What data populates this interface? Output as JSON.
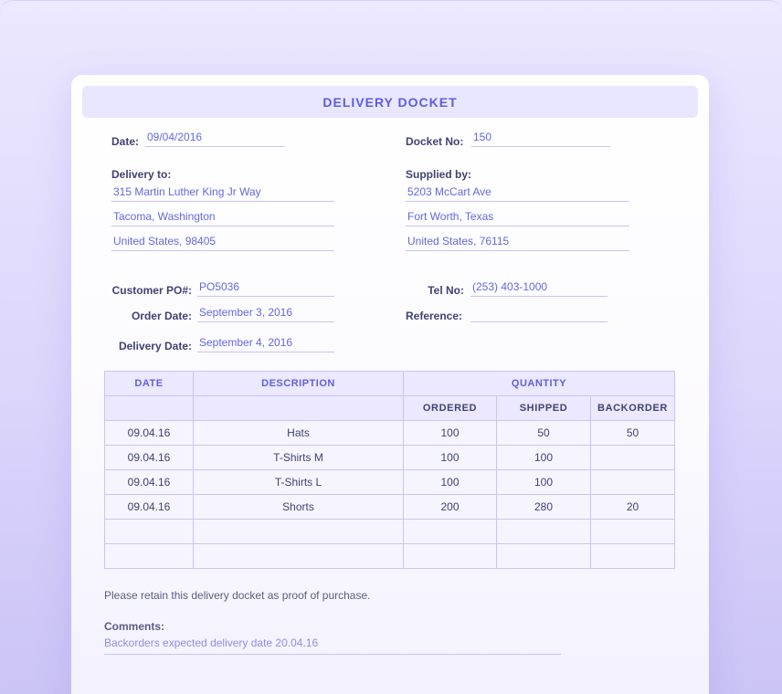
{
  "title": "DELIVERY DOCKET",
  "date": {
    "label": "Date:",
    "value": "09/04/2016"
  },
  "docket": {
    "label": "Docket No:",
    "value": "150"
  },
  "delivery_to": {
    "label": "Delivery to:",
    "lines": [
      "315 Martin Luther King Jr Way",
      "Tacoma, Washington",
      "United States, 98405"
    ]
  },
  "supplied_by": {
    "label": "Supplied by:",
    "lines": [
      "5203 McCart Ave",
      "Fort Worth, Texas",
      "United States, 76115"
    ]
  },
  "customer_po": {
    "label": "Customer PO#:",
    "value": "PO5036"
  },
  "order_date": {
    "label": "Order Date:",
    "value": "September 3, 2016"
  },
  "delivery_date": {
    "label": "Delivery Date:",
    "value": "September 4, 2016"
  },
  "tel": {
    "label": "Tel No:",
    "value": "(253) 403-1000"
  },
  "reference": {
    "label": "Reference:",
    "value": ""
  },
  "table": {
    "headers": {
      "date": "DATE",
      "description": "DESCRIPTION",
      "quantity": "QUANTITY"
    },
    "subheaders": {
      "ordered": "ORDERED",
      "shipped": "SHIPPED",
      "backorder": "BACKORDER"
    },
    "rows": [
      {
        "date": "09.04.16",
        "description": "Hats",
        "ordered": "100",
        "shipped": "50",
        "backorder": "50"
      },
      {
        "date": "09.04.16",
        "description": "T-Shirts M",
        "ordered": "100",
        "shipped": "100",
        "backorder": ""
      },
      {
        "date": "09.04.16",
        "description": "T-Shirts L",
        "ordered": "100",
        "shipped": "100",
        "backorder": ""
      },
      {
        "date": "09.04.16",
        "description": "Shorts",
        "ordered": "200",
        "shipped": "280",
        "backorder": "20"
      },
      {
        "date": "",
        "description": "",
        "ordered": "",
        "shipped": "",
        "backorder": ""
      },
      {
        "date": "",
        "description": "",
        "ordered": "",
        "shipped": "",
        "backorder": ""
      }
    ]
  },
  "note": "Please retain this delivery docket as proof of purchase.",
  "comments": {
    "label": "Comments:",
    "value": "Backorders expected delivery date 20.04.16"
  }
}
